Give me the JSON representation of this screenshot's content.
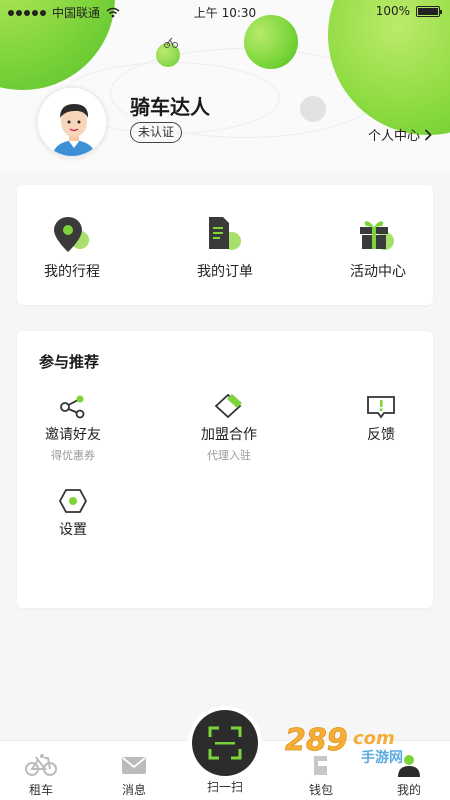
{
  "status_bar": {
    "carrier": "中国联通",
    "time": "上午 10:30",
    "battery": "100%",
    "battery_level": 1.0
  },
  "profile": {
    "username": "骑车达人",
    "verify_status": "未认证",
    "personal_center": "个人中心"
  },
  "main_menu": [
    {
      "label": "我的行程",
      "icon": "location-pin-icon"
    },
    {
      "label": "我的订单",
      "icon": "document-icon"
    },
    {
      "label": "活动中心",
      "icon": "gift-icon"
    }
  ],
  "recommend": {
    "title": "参与推荐",
    "items": [
      {
        "label": "邀请好友",
        "sub": "得优惠券",
        "icon": "share-icon"
      },
      {
        "label": "加盟合作",
        "sub": "代理入驻",
        "icon": "diamond-tag-icon"
      },
      {
        "label": "反馈",
        "sub": "",
        "icon": "feedback-icon"
      },
      {
        "label": "设置",
        "sub": "",
        "icon": "hexagon-settings-icon"
      }
    ]
  },
  "bottom_nav": {
    "rent": "租车",
    "messages": "消息",
    "scan": "扫一扫",
    "wallet": "钱包",
    "mine": "我的"
  },
  "colors": {
    "accent": "#7cd43a",
    "dark": "#2c2c2c"
  },
  "watermark": {
    "number": "289",
    "suffix": "com",
    "site": "手游网"
  }
}
